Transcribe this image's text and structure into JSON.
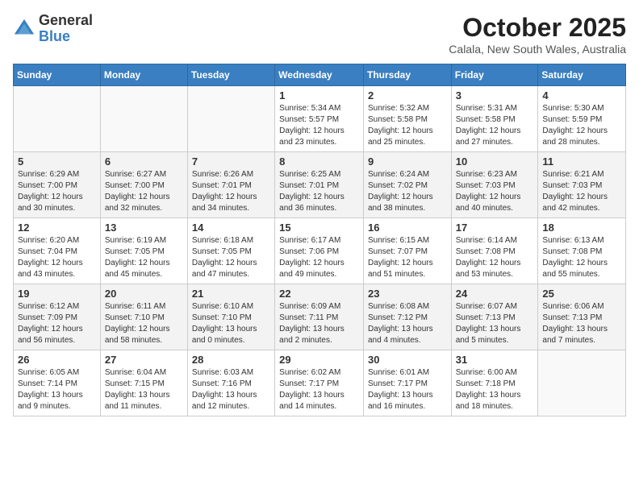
{
  "header": {
    "logo": {
      "general": "General",
      "blue": "Blue"
    },
    "month": "October 2025",
    "location": "Calala, New South Wales, Australia"
  },
  "weekdays": [
    "Sunday",
    "Monday",
    "Tuesday",
    "Wednesday",
    "Thursday",
    "Friday",
    "Saturday"
  ],
  "weeks": [
    [
      {
        "day": "",
        "info": ""
      },
      {
        "day": "",
        "info": ""
      },
      {
        "day": "",
        "info": ""
      },
      {
        "day": "1",
        "info": "Sunrise: 5:34 AM\nSunset: 5:57 PM\nDaylight: 12 hours\nand 23 minutes."
      },
      {
        "day": "2",
        "info": "Sunrise: 5:32 AM\nSunset: 5:58 PM\nDaylight: 12 hours\nand 25 minutes."
      },
      {
        "day": "3",
        "info": "Sunrise: 5:31 AM\nSunset: 5:58 PM\nDaylight: 12 hours\nand 27 minutes."
      },
      {
        "day": "4",
        "info": "Sunrise: 5:30 AM\nSunset: 5:59 PM\nDaylight: 12 hours\nand 28 minutes."
      }
    ],
    [
      {
        "day": "5",
        "info": "Sunrise: 6:29 AM\nSunset: 7:00 PM\nDaylight: 12 hours\nand 30 minutes."
      },
      {
        "day": "6",
        "info": "Sunrise: 6:27 AM\nSunset: 7:00 PM\nDaylight: 12 hours\nand 32 minutes."
      },
      {
        "day": "7",
        "info": "Sunrise: 6:26 AM\nSunset: 7:01 PM\nDaylight: 12 hours\nand 34 minutes."
      },
      {
        "day": "8",
        "info": "Sunrise: 6:25 AM\nSunset: 7:01 PM\nDaylight: 12 hours\nand 36 minutes."
      },
      {
        "day": "9",
        "info": "Sunrise: 6:24 AM\nSunset: 7:02 PM\nDaylight: 12 hours\nand 38 minutes."
      },
      {
        "day": "10",
        "info": "Sunrise: 6:23 AM\nSunset: 7:03 PM\nDaylight: 12 hours\nand 40 minutes."
      },
      {
        "day": "11",
        "info": "Sunrise: 6:21 AM\nSunset: 7:03 PM\nDaylight: 12 hours\nand 42 minutes."
      }
    ],
    [
      {
        "day": "12",
        "info": "Sunrise: 6:20 AM\nSunset: 7:04 PM\nDaylight: 12 hours\nand 43 minutes."
      },
      {
        "day": "13",
        "info": "Sunrise: 6:19 AM\nSunset: 7:05 PM\nDaylight: 12 hours\nand 45 minutes."
      },
      {
        "day": "14",
        "info": "Sunrise: 6:18 AM\nSunset: 7:05 PM\nDaylight: 12 hours\nand 47 minutes."
      },
      {
        "day": "15",
        "info": "Sunrise: 6:17 AM\nSunset: 7:06 PM\nDaylight: 12 hours\nand 49 minutes."
      },
      {
        "day": "16",
        "info": "Sunrise: 6:15 AM\nSunset: 7:07 PM\nDaylight: 12 hours\nand 51 minutes."
      },
      {
        "day": "17",
        "info": "Sunrise: 6:14 AM\nSunset: 7:08 PM\nDaylight: 12 hours\nand 53 minutes."
      },
      {
        "day": "18",
        "info": "Sunrise: 6:13 AM\nSunset: 7:08 PM\nDaylight: 12 hours\nand 55 minutes."
      }
    ],
    [
      {
        "day": "19",
        "info": "Sunrise: 6:12 AM\nSunset: 7:09 PM\nDaylight: 12 hours\nand 56 minutes."
      },
      {
        "day": "20",
        "info": "Sunrise: 6:11 AM\nSunset: 7:10 PM\nDaylight: 12 hours\nand 58 minutes."
      },
      {
        "day": "21",
        "info": "Sunrise: 6:10 AM\nSunset: 7:10 PM\nDaylight: 13 hours\nand 0 minutes."
      },
      {
        "day": "22",
        "info": "Sunrise: 6:09 AM\nSunset: 7:11 PM\nDaylight: 13 hours\nand 2 minutes."
      },
      {
        "day": "23",
        "info": "Sunrise: 6:08 AM\nSunset: 7:12 PM\nDaylight: 13 hours\nand 4 minutes."
      },
      {
        "day": "24",
        "info": "Sunrise: 6:07 AM\nSunset: 7:13 PM\nDaylight: 13 hours\nand 5 minutes."
      },
      {
        "day": "25",
        "info": "Sunrise: 6:06 AM\nSunset: 7:13 PM\nDaylight: 13 hours\nand 7 minutes."
      }
    ],
    [
      {
        "day": "26",
        "info": "Sunrise: 6:05 AM\nSunset: 7:14 PM\nDaylight: 13 hours\nand 9 minutes."
      },
      {
        "day": "27",
        "info": "Sunrise: 6:04 AM\nSunset: 7:15 PM\nDaylight: 13 hours\nand 11 minutes."
      },
      {
        "day": "28",
        "info": "Sunrise: 6:03 AM\nSunset: 7:16 PM\nDaylight: 13 hours\nand 12 minutes."
      },
      {
        "day": "29",
        "info": "Sunrise: 6:02 AM\nSunset: 7:17 PM\nDaylight: 13 hours\nand 14 minutes."
      },
      {
        "day": "30",
        "info": "Sunrise: 6:01 AM\nSunset: 7:17 PM\nDaylight: 13 hours\nand 16 minutes."
      },
      {
        "day": "31",
        "info": "Sunrise: 6:00 AM\nSunset: 7:18 PM\nDaylight: 13 hours\nand 18 minutes."
      },
      {
        "day": "",
        "info": ""
      }
    ]
  ]
}
